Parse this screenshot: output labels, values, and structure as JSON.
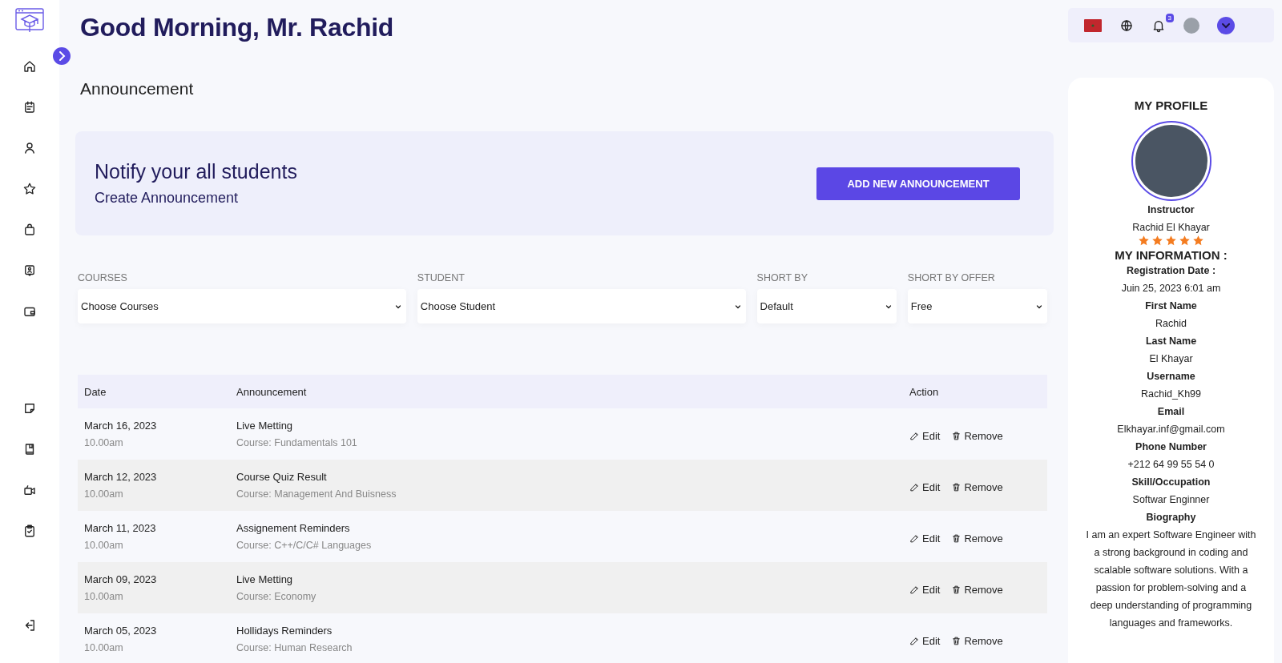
{
  "greeting": "Good Morning, Mr. Rachid",
  "page_title": "Announcement",
  "banner": {
    "title": "Notify your all students",
    "subtitle": "Create Announcement",
    "button": "ADD NEW ANNOUNCEMENT"
  },
  "filters": [
    {
      "label": "COURSES",
      "value": "Choose Courses"
    },
    {
      "label": "STUDENT",
      "value": "Choose Student"
    },
    {
      "label": "SHORT BY",
      "value": "Default"
    },
    {
      "label": "SHORT BY OFFER",
      "value": "Free"
    }
  ],
  "table": {
    "columns": [
      "Date",
      "Announcement",
      "Action"
    ],
    "rows": [
      {
        "date": "March 16, 2023",
        "time": "10.00am",
        "title": "Live Metting",
        "course": "Course: Fundamentals 101",
        "edit": "Edit",
        "remove": "Remove"
      },
      {
        "date": "March 12, 2023",
        "time": "10.00am",
        "title": "Course Quiz Result",
        "course": "Course: Management And Buisness",
        "edit": "Edit",
        "remove": "Remove"
      },
      {
        "date": "March 11, 2023",
        "time": "10.00am",
        "title": "Assignement Reminders",
        "course": "Course: C++/C/C# Languages",
        "edit": "Edit",
        "remove": "Remove"
      },
      {
        "date": "March 09, 2023",
        "time": "10.00am",
        "title": "Live Metting",
        "course": "Course: Economy",
        "edit": "Edit",
        "remove": "Remove"
      },
      {
        "date": "March 05, 2023",
        "time": "10.00am",
        "title": "Hollidays Reminders",
        "course": "Course: Human Research",
        "edit": "Edit",
        "remove": "Remove"
      }
    ]
  },
  "topbar": {
    "notification_count": "3"
  },
  "profile": {
    "title": "MY PROFILE",
    "role": "Instructor",
    "name": "Rachid El Khayar",
    "stars": 5,
    "info_title": "MY INFORMATION :",
    "fields": [
      {
        "label": "Registration Date :",
        "value": "Juin 25, 2023 6:01 am"
      },
      {
        "label": "First Name",
        "value": "Rachid"
      },
      {
        "label": "Last Name",
        "value": "El Khayar"
      },
      {
        "label": "Username",
        "value": "Rachid_Kh99"
      },
      {
        "label": "Email",
        "value": "Elkhayar.inf@gmail.com"
      },
      {
        "label": "Phone Number",
        "value": "+212 64 99 55 54 0"
      },
      {
        "label": "Skill/Occupation",
        "value": "Softwar Enginner"
      },
      {
        "label": "Biography",
        "value": "I am an expert Software Engineer with a strong background in coding and scalable software solutions. With a passion for problem-solving and a deep understanding of programming languages and frameworks."
      }
    ]
  }
}
